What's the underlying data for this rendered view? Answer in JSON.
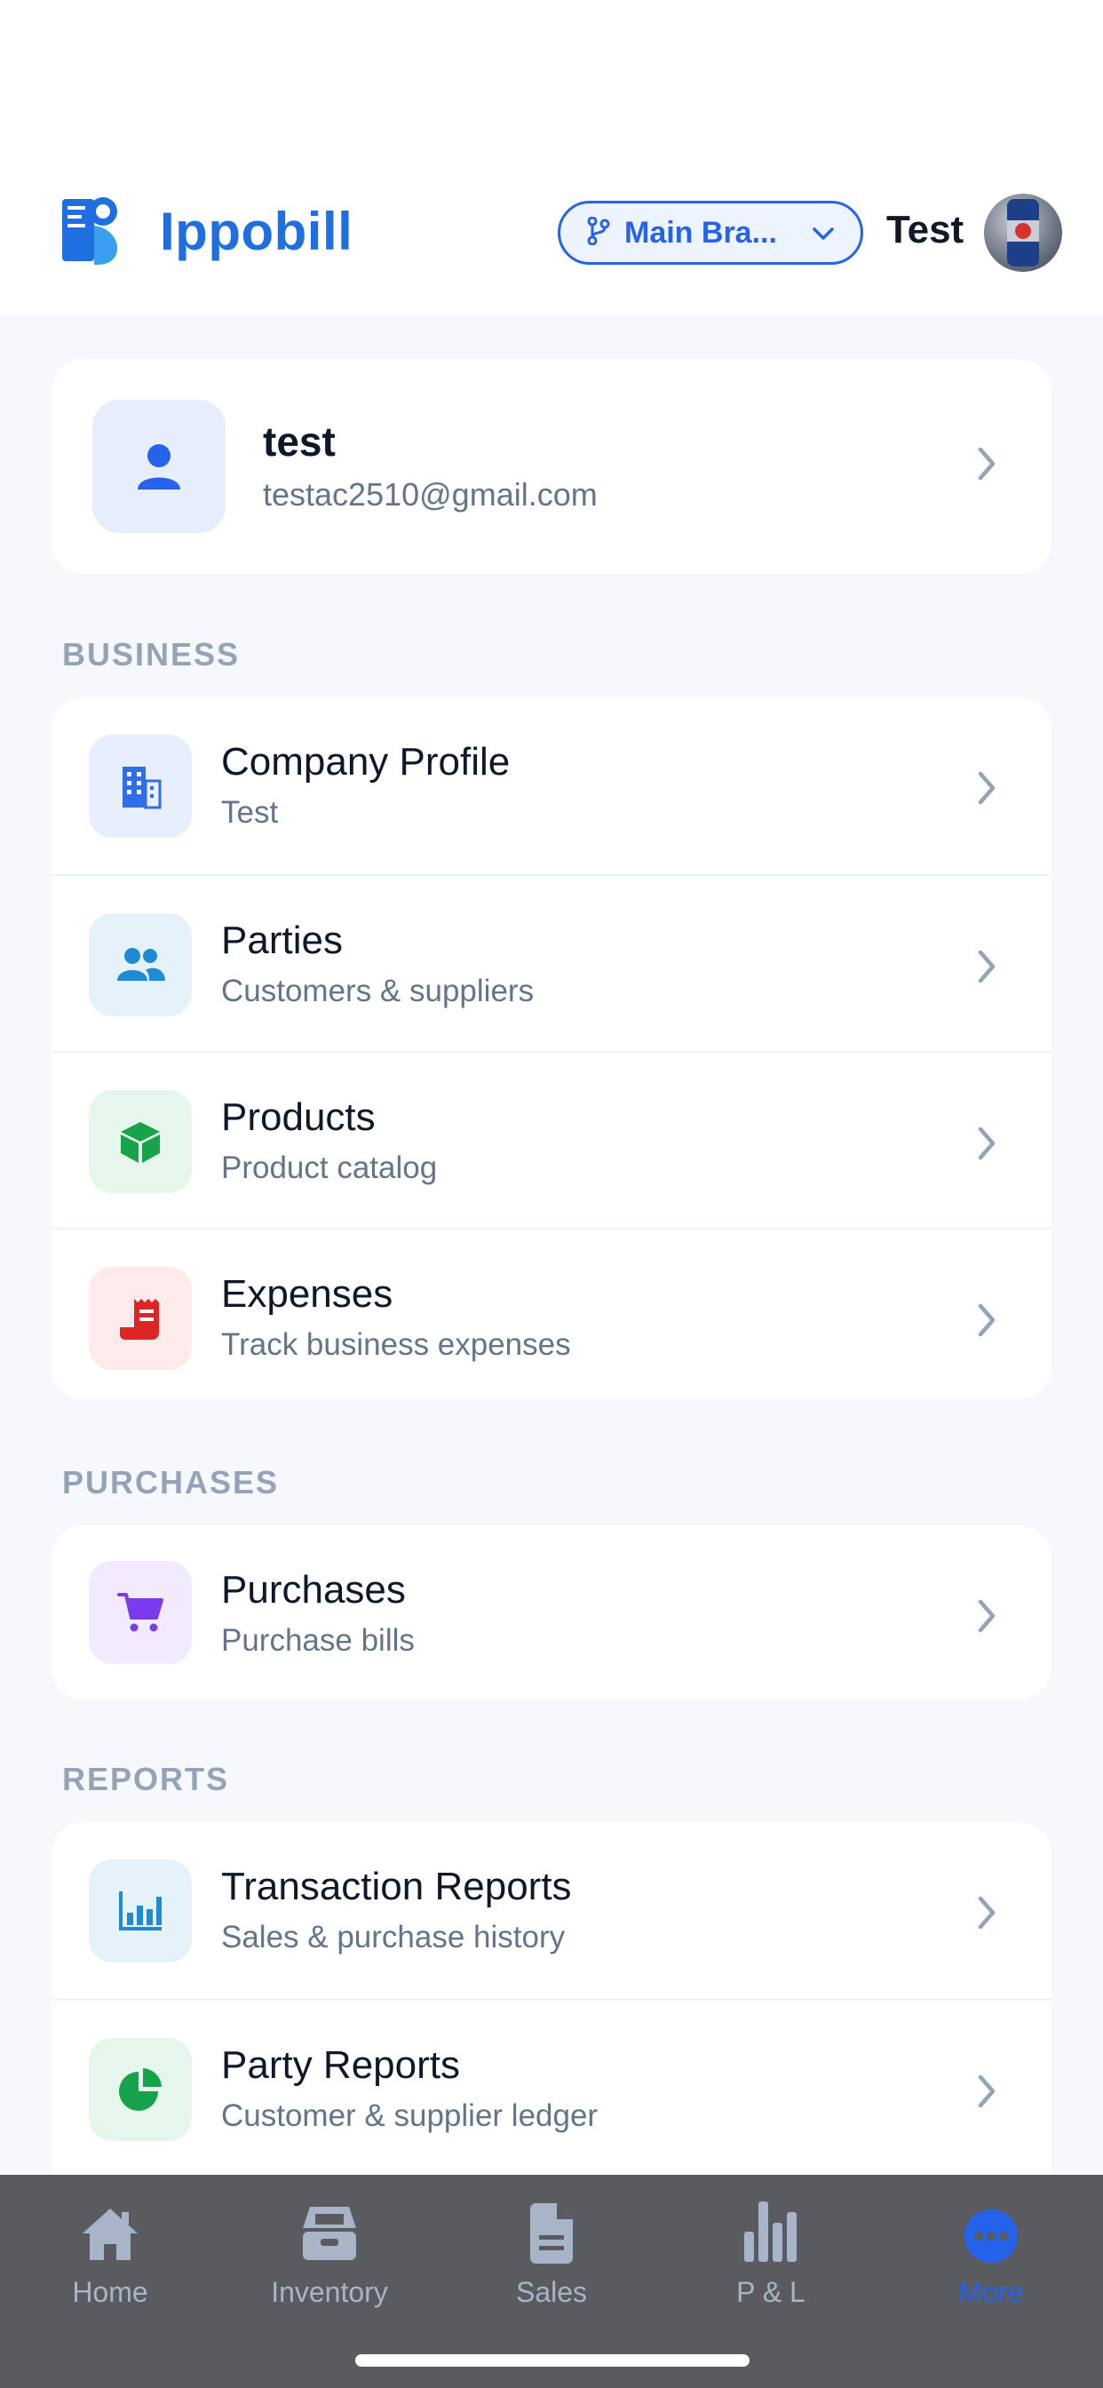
{
  "app": {
    "brand": "Ippobill",
    "branch": "Main Bra...",
    "user": "Test"
  },
  "profile": {
    "name": "test",
    "email": "testac2510@gmail.com"
  },
  "sections": {
    "business": {
      "title": "BUSINESS",
      "items": [
        {
          "title": "Company Profile",
          "sub": "Test",
          "icon": "building-icon",
          "color": "#2f6ee6",
          "bg": "#e8effc"
        },
        {
          "title": "Parties",
          "sub": "Customers & suppliers",
          "icon": "people-icon",
          "color": "#1f8ad6",
          "bg": "#e6f2fa"
        },
        {
          "title": "Products",
          "sub": "Product catalog",
          "icon": "box-icon",
          "color": "#16a34a",
          "bg": "#e7f6ec"
        },
        {
          "title": "Expenses",
          "sub": "Track business expenses",
          "icon": "receipt-icon",
          "color": "#dc2626",
          "bg": "#fdeaea"
        }
      ]
    },
    "purchases": {
      "title": "PURCHASES",
      "items": [
        {
          "title": "Purchases",
          "sub": "Purchase bills",
          "icon": "cart-icon",
          "color": "#7c3aed",
          "bg": "#f1ebfd"
        }
      ]
    },
    "reports": {
      "title": "REPORTS",
      "items": [
        {
          "title": "Transaction Reports",
          "sub": "Sales & purchase history",
          "icon": "bar-chart-icon",
          "color": "#1f8ad6",
          "bg": "#e6f2fa"
        },
        {
          "title": "Party Reports",
          "sub": "Customer & supplier ledger",
          "icon": "pie-chart-icon",
          "color": "#16a34a",
          "bg": "#e7f6ec"
        }
      ]
    }
  },
  "tabs": [
    {
      "label": "Home",
      "icon": "home-icon"
    },
    {
      "label": "Inventory",
      "icon": "inventory-icon"
    },
    {
      "label": "Sales",
      "icon": "document-icon"
    },
    {
      "label": "P & L",
      "icon": "bar-chart-icon"
    },
    {
      "label": "More",
      "icon": "more-icon",
      "active": true
    }
  ],
  "colors": {
    "accent": "#2563eb",
    "tabbar": "#5a5b5f",
    "tab_inactive": "#a8b4c8"
  }
}
